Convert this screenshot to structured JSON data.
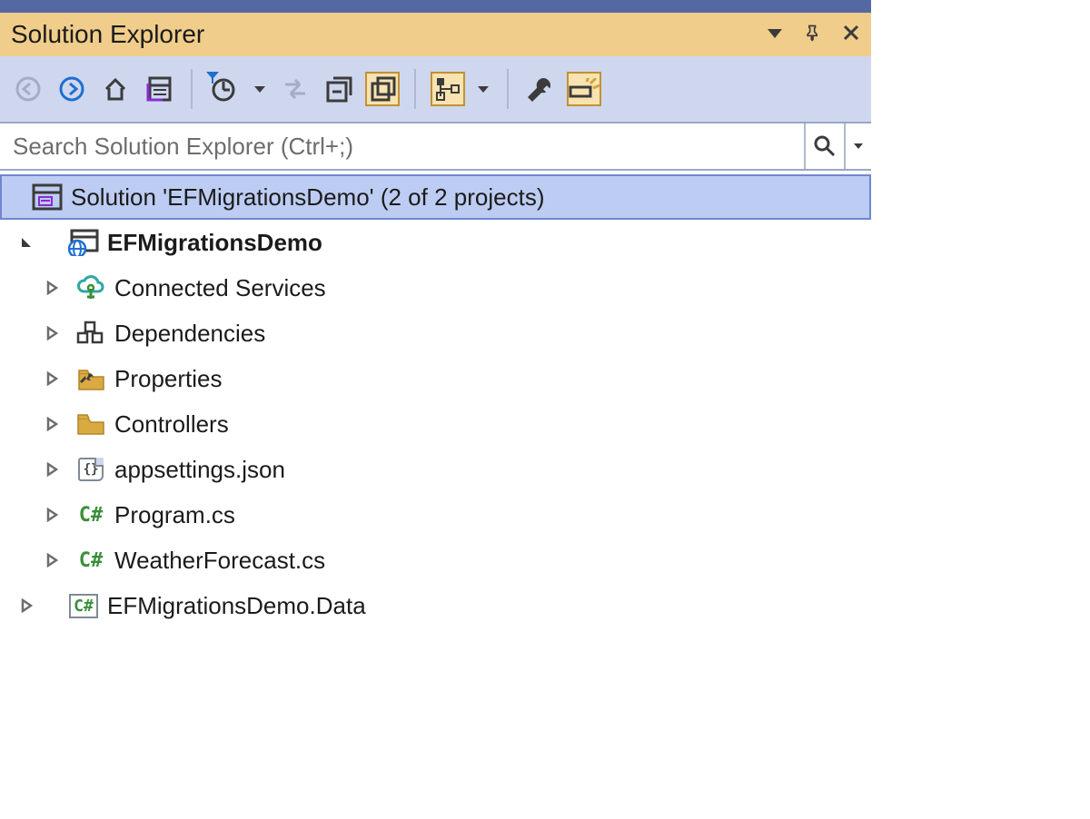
{
  "title": "Solution Explorer",
  "search": {
    "placeholder": "Search Solution Explorer (Ctrl+;)"
  },
  "solution": {
    "label": "Solution 'EFMigrationsDemo' (2 of 2 projects)"
  },
  "project": {
    "name": "EFMigrationsDemo",
    "children": {
      "connected": "Connected Services",
      "deps": "Dependencies",
      "props": "Properties",
      "controllers": "Controllers",
      "appsettings": "appsettings.json",
      "program": "Program.cs",
      "weather": "WeatherForecast.cs"
    }
  },
  "project2": {
    "name": "EFMigrationsDemo.Data"
  }
}
